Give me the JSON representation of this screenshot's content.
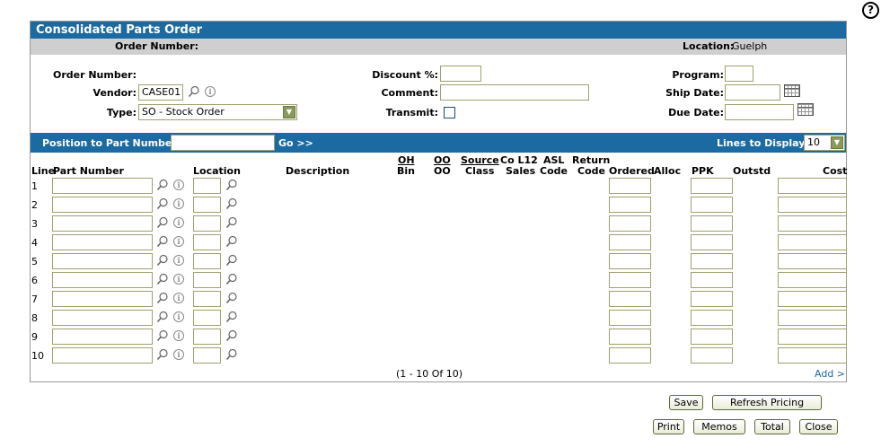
{
  "title": "Consolidated Parts Order",
  "sub_bar": {
    "order_number_label": "Order Number:",
    "location_label": "Location:",
    "location_value": "Guelph"
  },
  "form": {
    "order_number_label": "Order Number:",
    "vendor_label": "Vendor:",
    "vendor_value": "CASE01",
    "type_label": "Type:",
    "type_value": "SO - Stock Order",
    "discount_label": "Discount %:",
    "comment_label": "Comment:",
    "transmit_label": "Transmit:",
    "program_label": "Program:",
    "ship_date_label": "Ship Date:",
    "due_date_label": "Due Date:"
  },
  "position_bar": {
    "label": "Position to Part Number:",
    "go_label": "Go >>",
    "lines_label": "Lines to Display:",
    "lines_value": "10"
  },
  "table": {
    "headers": {
      "line": "Line",
      "part_number": "Part Number",
      "location": "Location",
      "description": "Description",
      "oh_top": "OH",
      "oh_bottom": "Bin",
      "oo_top": "OO",
      "oo_bottom": "OO",
      "source_top": "Source",
      "source_bottom": "Class",
      "col12_top": "Co L12",
      "col12_bottom": "Sales",
      "asl_top": "ASL",
      "asl_bottom": "Code",
      "return_top": "Return",
      "return_bottom": "Code",
      "ordered": "Ordered",
      "alloc": "Alloc",
      "ppk": "PPK",
      "outstd": "Outstd",
      "cost": "Cost"
    },
    "rows": [
      "1",
      "2",
      "3",
      "4",
      "5",
      "6",
      "7",
      "8",
      "9",
      "10"
    ],
    "pagination": "(1 - 10 Of 10)",
    "add_link": "Add >"
  },
  "buttons": {
    "save": "Save",
    "refresh_pricing": "Refresh Pricing",
    "print": "Print",
    "memos": "Memos",
    "total": "Total",
    "close": "Close"
  },
  "help_glyph": "?",
  "colors": {
    "header_blue": "#1c6aa2",
    "sub_bar_gray": "#cfcfcf",
    "input_border": "#a0a070"
  }
}
